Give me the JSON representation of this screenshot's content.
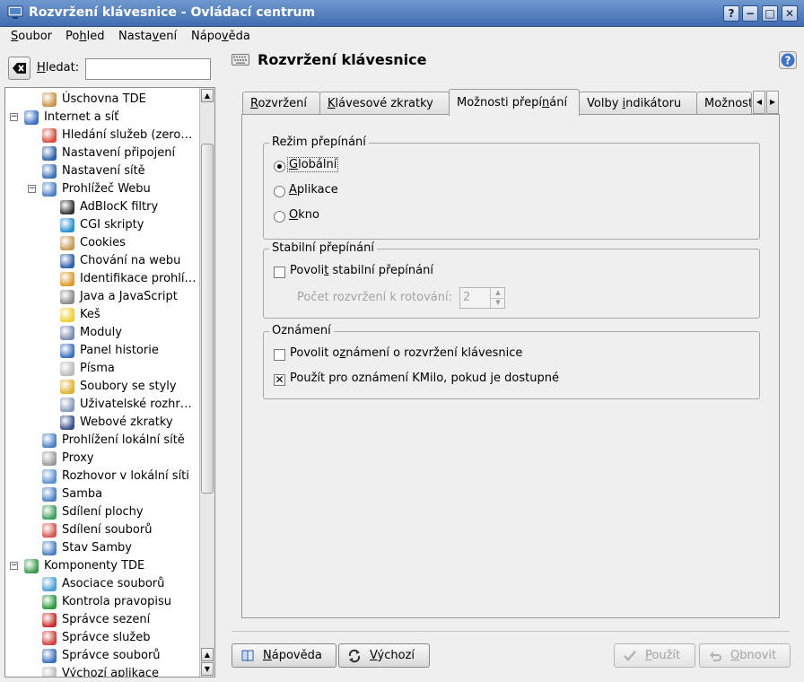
{
  "window": {
    "title": "Rozvržení klávesnice - Ovládací centrum",
    "buttons": [
      "?",
      "−",
      "□",
      "✕"
    ]
  },
  "menubar": {
    "items": [
      {
        "pre": "",
        "acc": "S",
        "post": "oubor"
      },
      {
        "pre": "Po",
        "acc": "h",
        "post": "led"
      },
      {
        "pre": "Nasta",
        "acc": "v",
        "post": "ení"
      },
      {
        "pre": "Nápo",
        "acc": "v",
        "post": "ěda"
      }
    ]
  },
  "search": {
    "label_pre": "",
    "label_acc": "H",
    "label_post": "ledat:",
    "value": ""
  },
  "tree": {
    "items": [
      {
        "label": "Úschovna TDE",
        "level": 1,
        "icon": "wallet-icon",
        "color": "#c8954a"
      },
      {
        "label": "Internet a síť",
        "level": 0,
        "icon": "network-globe-icon",
        "color": "#3a6fbf",
        "expander": "−"
      },
      {
        "label": "Hledání služeb (zero…",
        "level": 1,
        "icon": "service-discovery-icon",
        "color": "#d94b3d"
      },
      {
        "label": "Nastavení připojení",
        "level": 1,
        "icon": "connection-icon",
        "color": "#2f5fa8"
      },
      {
        "label": "Nastavení sítě",
        "level": 1,
        "icon": "network-settings-icon",
        "color": "#3b6fb5"
      },
      {
        "label": "Prohlížeč Webu",
        "level": 1,
        "icon": "web-browser-icon",
        "color": "#4a7fc4",
        "expander": "−"
      },
      {
        "label": "AdBlocK filtry",
        "level": 2,
        "icon": "funnel-icon",
        "color": "#333333"
      },
      {
        "label": "CGI skripty",
        "level": 2,
        "icon": "gear-icon",
        "color": "#2a8fd0"
      },
      {
        "label": "Cookies",
        "level": 2,
        "icon": "cookie-icon",
        "color": "#c79a55"
      },
      {
        "label": "Chování na webu",
        "level": 2,
        "icon": "globe-icon",
        "color": "#2f5fa8"
      },
      {
        "label": "Identifikace prohlí…",
        "level": 2,
        "icon": "identification-icon",
        "color": "#d99a2a"
      },
      {
        "label": "Java a JavaScript",
        "level": 2,
        "icon": "java-icon",
        "color": "#8a8a8a"
      },
      {
        "label": "Keš",
        "level": 2,
        "icon": "cache-icon",
        "color": "#f0d030"
      },
      {
        "label": "Moduly",
        "level": 2,
        "icon": "plugin-icon",
        "color": "#7a8ab0"
      },
      {
        "label": "Panel historie",
        "level": 2,
        "icon": "history-clock-icon",
        "color": "#3a6fbf"
      },
      {
        "label": "Písma",
        "level": 2,
        "icon": "fonts-icon",
        "color": "#bbbbbb"
      },
      {
        "label": "Soubory se styly",
        "level": 2,
        "icon": "css-icon",
        "color": "#e0b030"
      },
      {
        "label": "Uživatelské rozhr…",
        "level": 2,
        "icon": "user-interface-icon",
        "color": "#8899bb"
      },
      {
        "label": "Webové zkratky",
        "level": 2,
        "icon": "web-shortcuts-icon",
        "color": "#3a4f8a"
      },
      {
        "label": "Prohlížení lokální sítě",
        "level": 1,
        "icon": "lan-browsing-icon",
        "color": "#4a7fc4"
      },
      {
        "label": "Proxy",
        "level": 1,
        "icon": "proxy-icon",
        "color": "#999999"
      },
      {
        "label": "Rozhovor v lokální síti",
        "level": 1,
        "icon": "lan-chat-icon",
        "color": "#5a8fd0"
      },
      {
        "label": "Samba",
        "level": 1,
        "icon": "samba-icon",
        "color": "#4a7fc4"
      },
      {
        "label": "Sdílení plochy",
        "level": 1,
        "icon": "desktop-sharing-icon",
        "color": "#3aa05a"
      },
      {
        "label": "Sdílení souborů",
        "level": 1,
        "icon": "file-sharing-icon",
        "color": "#d9534f"
      },
      {
        "label": "Stav Samby",
        "level": 1,
        "icon": "samba-status-icon",
        "color": "#4a7fc4"
      },
      {
        "label": "Komponenty TDE",
        "level": 0,
        "icon": "components-icon",
        "color": "#3a9a4a",
        "expander": "−"
      },
      {
        "label": "Asociace souborů",
        "level": 1,
        "icon": "file-association-icon",
        "color": "#4a9fd8"
      },
      {
        "label": "Kontrola pravopisu",
        "level": 1,
        "icon": "spellcheck-icon",
        "color": "#2a9a3a"
      },
      {
        "label": "Správce sezení",
        "level": 1,
        "icon": "session-manager-icon",
        "color": "#cc2a2a"
      },
      {
        "label": "Správce služeb",
        "level": 1,
        "icon": "service-manager-icon",
        "color": "#d04040"
      },
      {
        "label": "Správce souborů",
        "level": 1,
        "icon": "file-manager-icon",
        "color": "#3a6fbf"
      },
      {
        "label": "Výchozí aplikace",
        "level": 1,
        "icon": "default-apps-icon",
        "color": "#bbbbbb"
      }
    ]
  },
  "module": {
    "title": "Rozvržení klávesnice"
  },
  "tabs": [
    {
      "pre": "",
      "acc": "R",
      "post": "ozvržení"
    },
    {
      "pre": "",
      "acc": "K",
      "post": "lávesové zkratky"
    },
    {
      "pre": "Možnosti přepí",
      "acc": "n",
      "post": "ání"
    },
    {
      "pre": "Volby ",
      "acc": "i",
      "post": "ndikátoru"
    },
    {
      "pre": "Možnost",
      "acc": "",
      "post": ""
    }
  ],
  "switch_mode": {
    "title": "Režim přepínání",
    "options": [
      {
        "pre": "",
        "acc": "G",
        "post": "lobální",
        "selected": true
      },
      {
        "pre": "",
        "acc": "A",
        "post": "plikace",
        "selected": false
      },
      {
        "pre": "",
        "acc": "O",
        "post": "kno",
        "selected": false
      }
    ]
  },
  "sticky": {
    "title": "Stabilní přepínání",
    "enable_pre": "Povoli",
    "enable_acc": "t",
    "enable_post": " stabilní přepínání",
    "enable_checked": false,
    "count_label": "Počet rozvržení k rotování:",
    "count_value": "2"
  },
  "notification": {
    "title": "Oznámení",
    "items": [
      {
        "pre": "Povolit o",
        "acc": "z",
        "post": "námení o rozvržení klávesnice",
        "checked": false
      },
      {
        "pre": "Použít pro oznámení KMilo, pokud ",
        "acc": "j",
        "post": "e dostupné",
        "checked": true
      }
    ]
  },
  "buttons": {
    "help": {
      "pre": "",
      "acc": "N",
      "post": "ápověda"
    },
    "defaults": {
      "pre": "",
      "acc": "V",
      "post": "ýchozí"
    },
    "apply": {
      "pre": "",
      "acc": "P",
      "post": "oužít"
    },
    "reset": {
      "pre": "",
      "acc": "O",
      "post": "bnovit"
    }
  }
}
